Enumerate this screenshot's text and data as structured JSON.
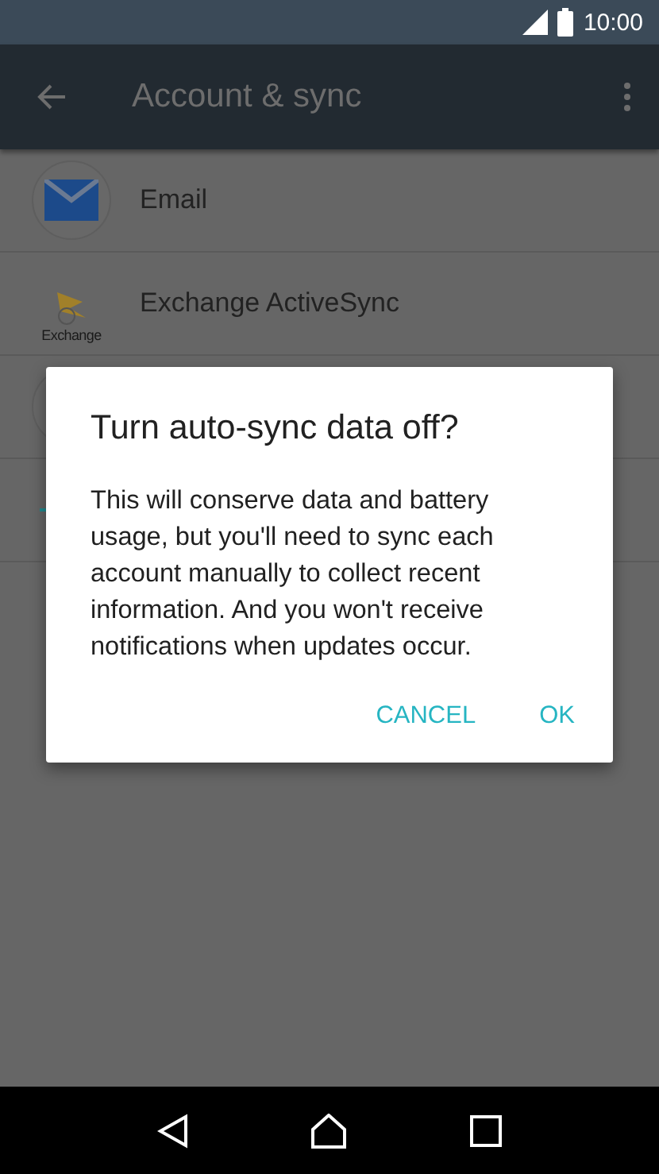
{
  "status_bar": {
    "time": "10:00"
  },
  "app_bar": {
    "title": "Account & sync"
  },
  "accounts": [
    {
      "kind": "email",
      "label": "Email"
    },
    {
      "kind": "exchange",
      "label": "Exchange ActiveSync",
      "logo_text": "Exchange"
    },
    {
      "kind": "hidden"
    },
    {
      "kind": "toggle"
    }
  ],
  "dialog": {
    "title": "Turn auto-sync data off?",
    "message": "This will conserve data and battery usage, but you'll need to sync each account manually to collect recent information. And you won't receive notifications when updates occur.",
    "buttons": [
      "CANCEL",
      "OK"
    ]
  }
}
